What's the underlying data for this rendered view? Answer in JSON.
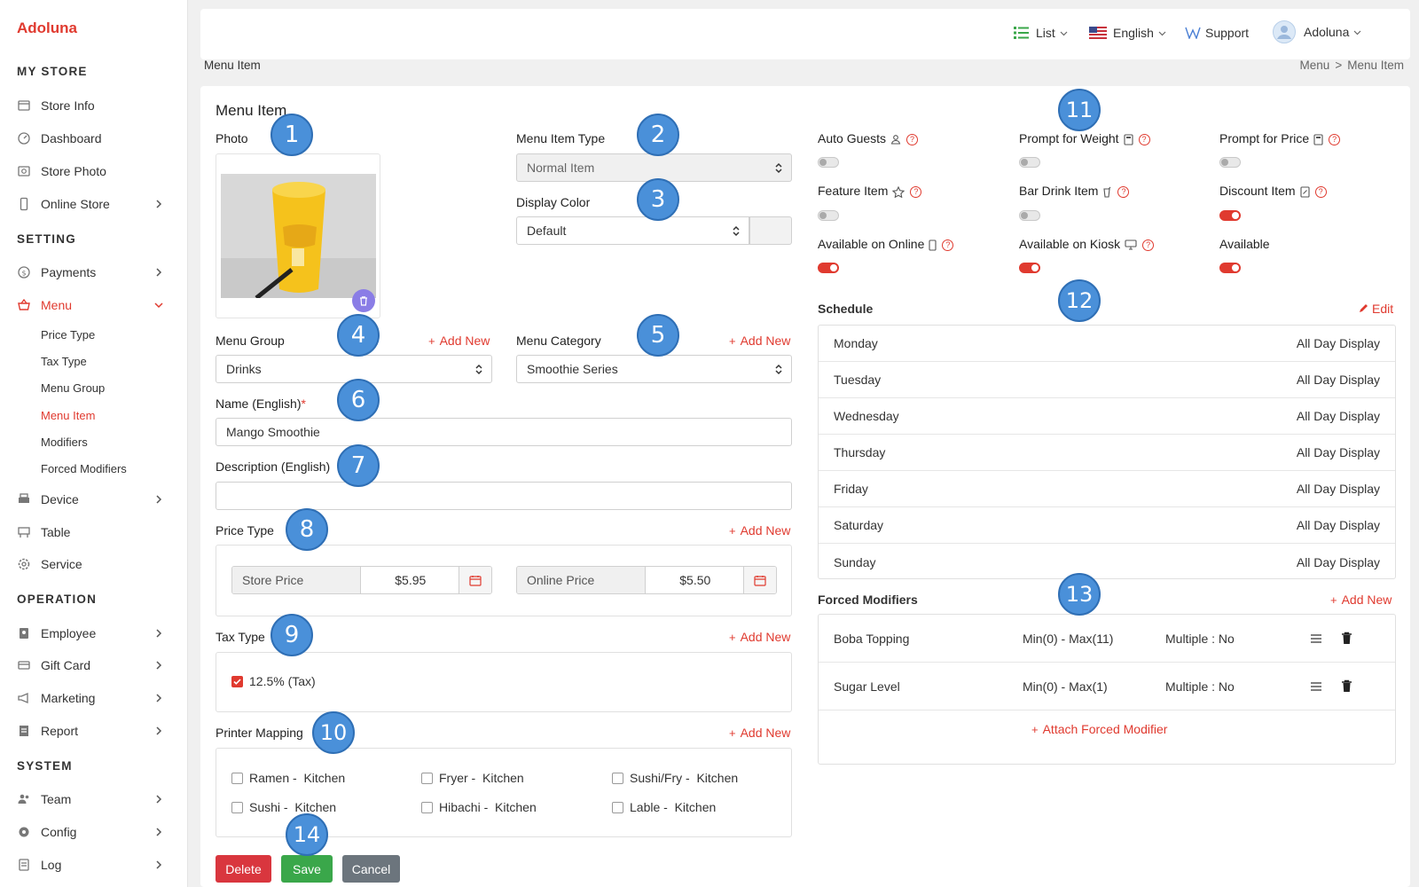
{
  "app": {
    "logo": "Adoluna"
  },
  "sidebar": {
    "sections": [
      "MY STORE",
      "SETTING",
      "OPERATION",
      "SYSTEM"
    ],
    "items": {
      "store_info": "Store Info",
      "dashboard": "Dashboard",
      "store_photo": "Store Photo",
      "online_store": "Online Store",
      "payments": "Payments",
      "menu": "Menu",
      "device": "Device",
      "table": "Table",
      "service": "Service",
      "employee": "Employee",
      "gift_card": "Gift Card",
      "marketing": "Marketing",
      "report": "Report",
      "team": "Team",
      "config": "Config",
      "log": "Log"
    },
    "menu_sub": [
      "Price Type",
      "Tax Type",
      "Menu Group",
      "Menu Item",
      "Modifiers",
      "Forced Modifiers"
    ]
  },
  "topbar": {
    "view": "List",
    "language": "English",
    "support": "Support",
    "user": "Adoluna"
  },
  "page": {
    "heading": "Menu Item",
    "breadcrumb": [
      "Menu",
      "Menu Item"
    ]
  },
  "form": {
    "title": "Menu Item",
    "photo_label": "Photo",
    "menu_item_type_label": "Menu Item Type",
    "menu_item_type_value": "Normal Item",
    "display_color_label": "Display Color",
    "display_color_value": "Default",
    "menu_group_label": "Menu Group",
    "menu_group_value": "Drinks",
    "menu_category_label": "Menu Category",
    "menu_category_value": "Smoothie Series",
    "add_new": "Add New",
    "name_label": "Name (English)",
    "required_mark": "*",
    "name_value": "Mango Smoothie",
    "description_label": "Description (English)",
    "description_value": "",
    "price_type_label": "Price Type",
    "store_price_label": "Store Price",
    "store_price_value": "$5.95",
    "online_price_label": "Online Price",
    "online_price_value": "$5.50",
    "tax_type_label": "Tax Type",
    "tax_option": "12.5% (Tax)",
    "printer_mapping_label": "Printer Mapping",
    "printers": [
      {
        "name": "Ramen -",
        "dest": "Kitchen"
      },
      {
        "name": "Fryer -",
        "dest": "Kitchen"
      },
      {
        "name": "Sushi/Fry -",
        "dest": "Kitchen"
      },
      {
        "name": "Sushi -",
        "dest": "Kitchen"
      },
      {
        "name": "Hibachi -",
        "dest": "Kitchen"
      },
      {
        "name": "Lable -",
        "dest": "Kitchen"
      }
    ],
    "buttons": {
      "delete": "Delete",
      "save": "Save",
      "cancel": "Cancel"
    }
  },
  "options": {
    "auto_guests": {
      "label": "Auto Guests",
      "on": false
    },
    "prompt_weight": {
      "label": "Prompt for Weight",
      "on": false
    },
    "prompt_price": {
      "label": "Prompt for Price",
      "on": false
    },
    "feature_item": {
      "label": "Feature Item",
      "on": false
    },
    "bar_drink": {
      "label": "Bar Drink Item",
      "on": false
    },
    "discount_item": {
      "label": "Discount Item",
      "on": true
    },
    "available_online": {
      "label": "Available on Online",
      "on": true
    },
    "available_kiosk": {
      "label": "Available on Kiosk",
      "on": true
    },
    "available": {
      "label": "Available",
      "on": true
    }
  },
  "schedule": {
    "title": "Schedule",
    "edit": "Edit",
    "rows": [
      {
        "day": "Monday",
        "value": "All Day Display"
      },
      {
        "day": "Tuesday",
        "value": "All Day Display"
      },
      {
        "day": "Wednesday",
        "value": "All Day Display"
      },
      {
        "day": "Thursday",
        "value": "All Day Display"
      },
      {
        "day": "Friday",
        "value": "All Day Display"
      },
      {
        "day": "Saturday",
        "value": "All Day Display"
      },
      {
        "day": "Sunday",
        "value": "All Day Display"
      }
    ]
  },
  "forced_modifiers": {
    "title": "Forced Modifiers",
    "add_new": "Add New",
    "rows": [
      {
        "name": "Boba Topping",
        "range": "Min(0) - Max(11)",
        "multiple": "Multiple : No"
      },
      {
        "name": "Sugar Level",
        "range": "Min(0) - Max(1)",
        "multiple": "Multiple : No"
      }
    ],
    "attach": "Attach Forced Modifier"
  },
  "annotations": [
    "1",
    "2",
    "3",
    "4",
    "5",
    "6",
    "7",
    "8",
    "9",
    "10",
    "11",
    "12",
    "13",
    "14"
  ],
  "colors": {
    "accent": "#e03a2f",
    "badge": "#4a90d9",
    "save": "#3aa74a",
    "delete": "#d9363e",
    "cancel": "#6c757d"
  }
}
